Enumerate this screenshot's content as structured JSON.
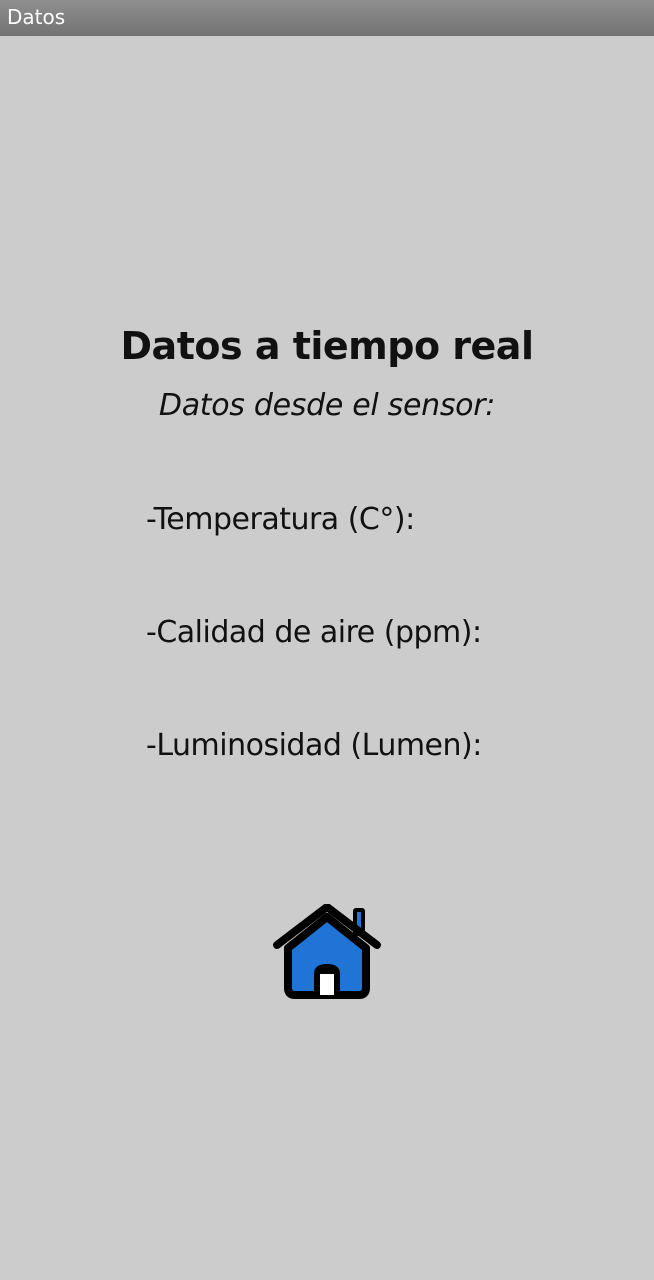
{
  "window": {
    "title": "Datos"
  },
  "main": {
    "heading": "Datos a tiempo real",
    "subheading": "Datos desde el sensor:",
    "readings": [
      {
        "label": "-Temperatura (C°):",
        "value": ""
      },
      {
        "label": "-Calidad de aire (ppm):",
        "value": ""
      },
      {
        "label": "-Luminosidad (Lumen):",
        "value": ""
      }
    ]
  },
  "home_button": {
    "icon": "home-icon",
    "fill_color": "#1f74d6",
    "outline_color": "#000000"
  },
  "colors": {
    "background": "#cccccc",
    "titlebar": "#7d7d7d"
  }
}
